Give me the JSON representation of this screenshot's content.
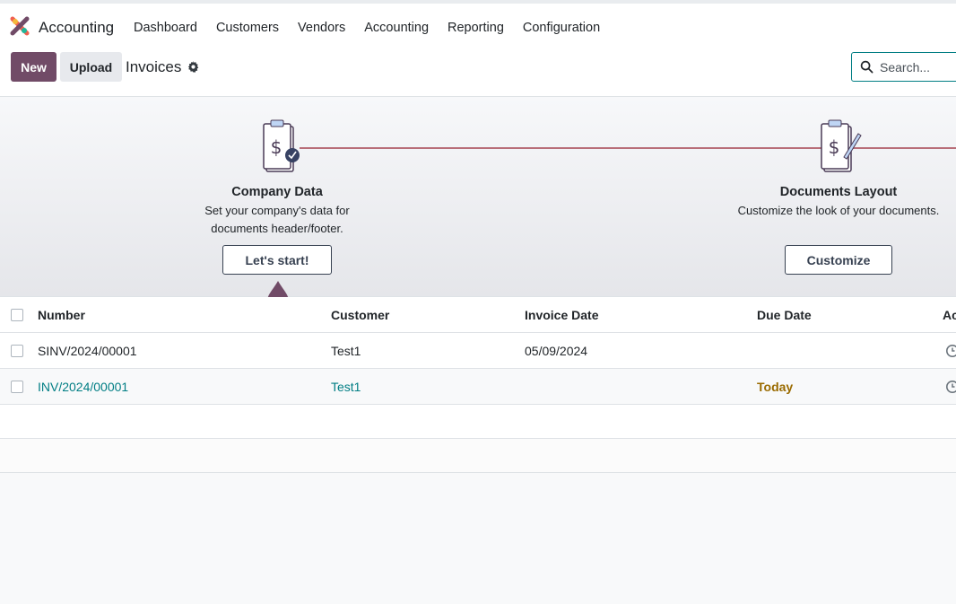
{
  "topbar": {
    "app_name": "Accounting",
    "menu": [
      "Dashboard",
      "Customers",
      "Vendors",
      "Accounting",
      "Reporting",
      "Configuration"
    ]
  },
  "control": {
    "new_label": "New",
    "upload_label": "Upload",
    "title": "Invoices",
    "search_placeholder": "Search..."
  },
  "onboarding": {
    "step1": {
      "title": "Company Data",
      "desc_line1": "Set your company's data for",
      "desc_line2": "documents header/footer.",
      "button": "Let's start!"
    },
    "step2": {
      "title": "Documents Layout",
      "desc": "Customize the look of your documents.",
      "button": "Customize"
    }
  },
  "table": {
    "columns": [
      "Number",
      "Customer",
      "Invoice Date",
      "Due Date",
      "Ac"
    ],
    "rows": [
      {
        "number": "SINV/2024/00001",
        "customer": "Test1",
        "invoice_date": "05/09/2024",
        "due_date": ""
      },
      {
        "number": "INV/2024/00001",
        "customer": "Test1",
        "invoice_date": "",
        "due_date": "Today"
      }
    ]
  },
  "colors": {
    "brand": "#714b67",
    "link": "#017e84",
    "due_today": "#9a6b00"
  },
  "icons": [
    "odoo-logo-icon",
    "gear-icon",
    "search-icon",
    "clipboard-dollar-check-icon",
    "clipboard-dollar-pen-icon",
    "clock-icon"
  ]
}
